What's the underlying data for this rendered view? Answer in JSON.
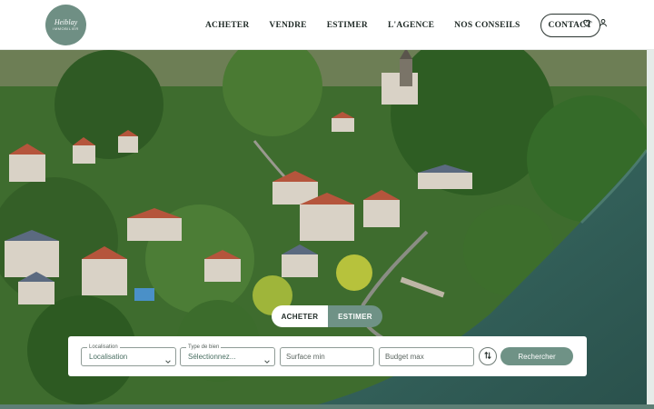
{
  "brand": {
    "name": "Heiblay",
    "sub": "IMMOBILIER"
  },
  "nav": {
    "items": [
      "ACHETER",
      "VENDRE",
      "ESTIMER",
      "L'AGENCE",
      "NOS CONSEILS"
    ],
    "contact": "CONTACT"
  },
  "icons": {
    "favorites": "heart-icon",
    "account": "user-icon"
  },
  "search": {
    "tabs": {
      "active": "ACHETER",
      "inactive": "ESTIMER"
    },
    "location": {
      "label": "Localisation",
      "value": "Localisation"
    },
    "type": {
      "label": "Type de bien",
      "value": "Sélectionnez..."
    },
    "surface_placeholder": "Surface min",
    "budget_placeholder": "Budget max",
    "submit": "Rechercher"
  },
  "colors": {
    "accent": "#6f9286",
    "river": "#2f5a55",
    "forest": "#3f6e2f"
  }
}
